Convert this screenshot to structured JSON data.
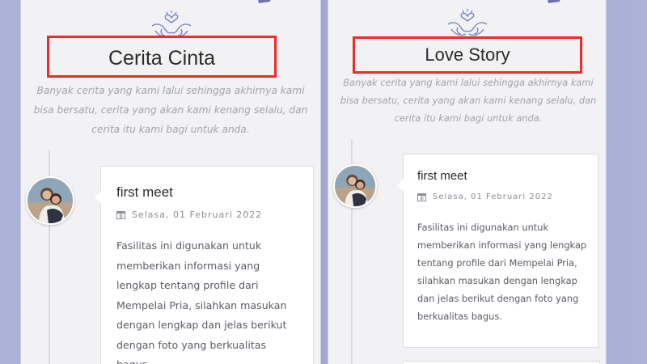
{
  "panels": [
    {
      "title": "Cerita Cinta",
      "subtitle": "Banyak cerita yang kami lalui sehingga akhirnya kami bisa bersatu, cerita yang akan kami kenang selalu, dan cerita itu kami bagi untuk anda.",
      "story": {
        "title": "first meet",
        "date": "Selasa, 01 Februari 2022",
        "body": "Fasilitas ini digunakan untuk memberikan informasi yang lengkap tentang profile dari Mempelai Pria, silahkan masukan dengan lengkap dan jelas berikut dengan foto yang berkualitas bagus."
      }
    },
    {
      "title": "Love Story",
      "subtitle": "Banyak cerita yang kami lalui sehingga akhirnya kami bisa bersatu, cerita yang akan kami kenang selalu, dan cerita itu kami bagi untuk anda.",
      "story": {
        "title": "first meet",
        "date": "Selasa, 01 Februari 2022",
        "body": "Fasilitas ini digunakan untuk memberikan informasi yang lengkap tentang profile dari Mempelai Pria, silahkan masukan dengan lengkap dan jelas berikut dengan foto yang berkualitas bagus."
      }
    }
  ],
  "colors": {
    "highlight": "#ec2b2b",
    "accent": "#7b86c6",
    "background": "#a5aed4"
  },
  "icons": [
    "heart-ornament-icon",
    "calendar-icon"
  ]
}
